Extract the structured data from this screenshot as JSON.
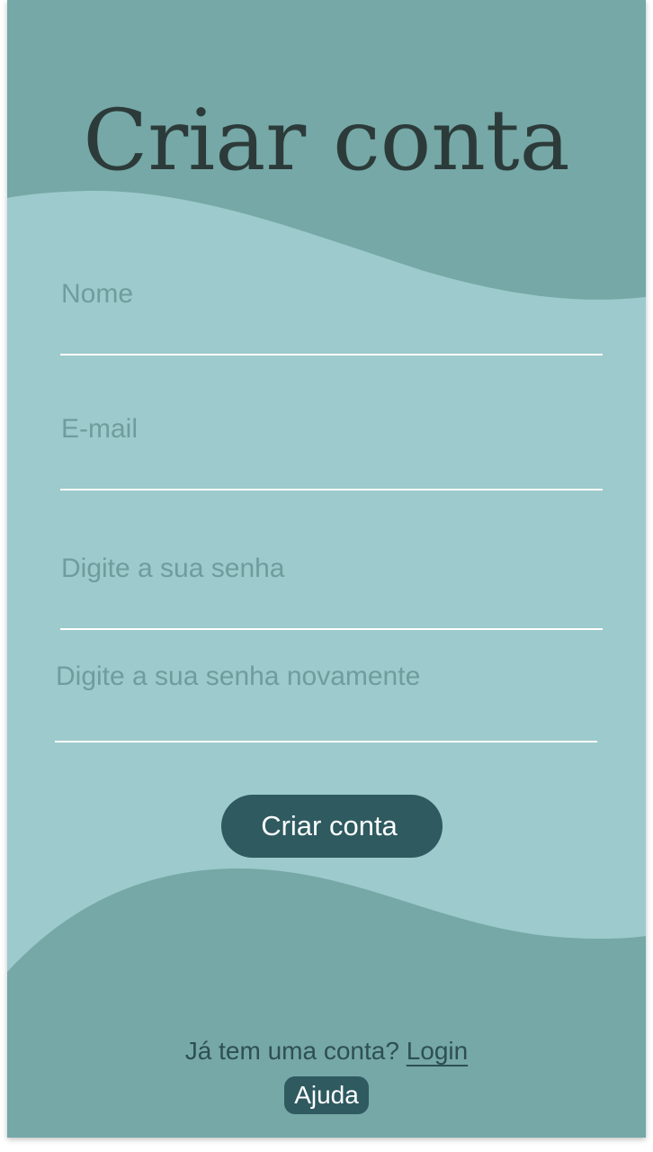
{
  "header": {
    "title": "Criar conta"
  },
  "form": {
    "nome": {
      "placeholder": "Nome",
      "value": ""
    },
    "email": {
      "placeholder": "E-mail",
      "value": ""
    },
    "senha": {
      "placeholder": "Digite a sua senha",
      "value": ""
    },
    "senha_confirm": {
      "placeholder": "Digite a sua senha novamente",
      "value": ""
    },
    "submit_label": "Criar conta"
  },
  "footer": {
    "prompt": "Já tem uma conta?",
    "login_label": "Login",
    "help_label": "Ajuda"
  },
  "colors": {
    "background": "#9dcacc",
    "wave": "#75a8a6",
    "button": "#2e5a60",
    "title": "#2c3b3a",
    "underline": "#ffffff"
  }
}
